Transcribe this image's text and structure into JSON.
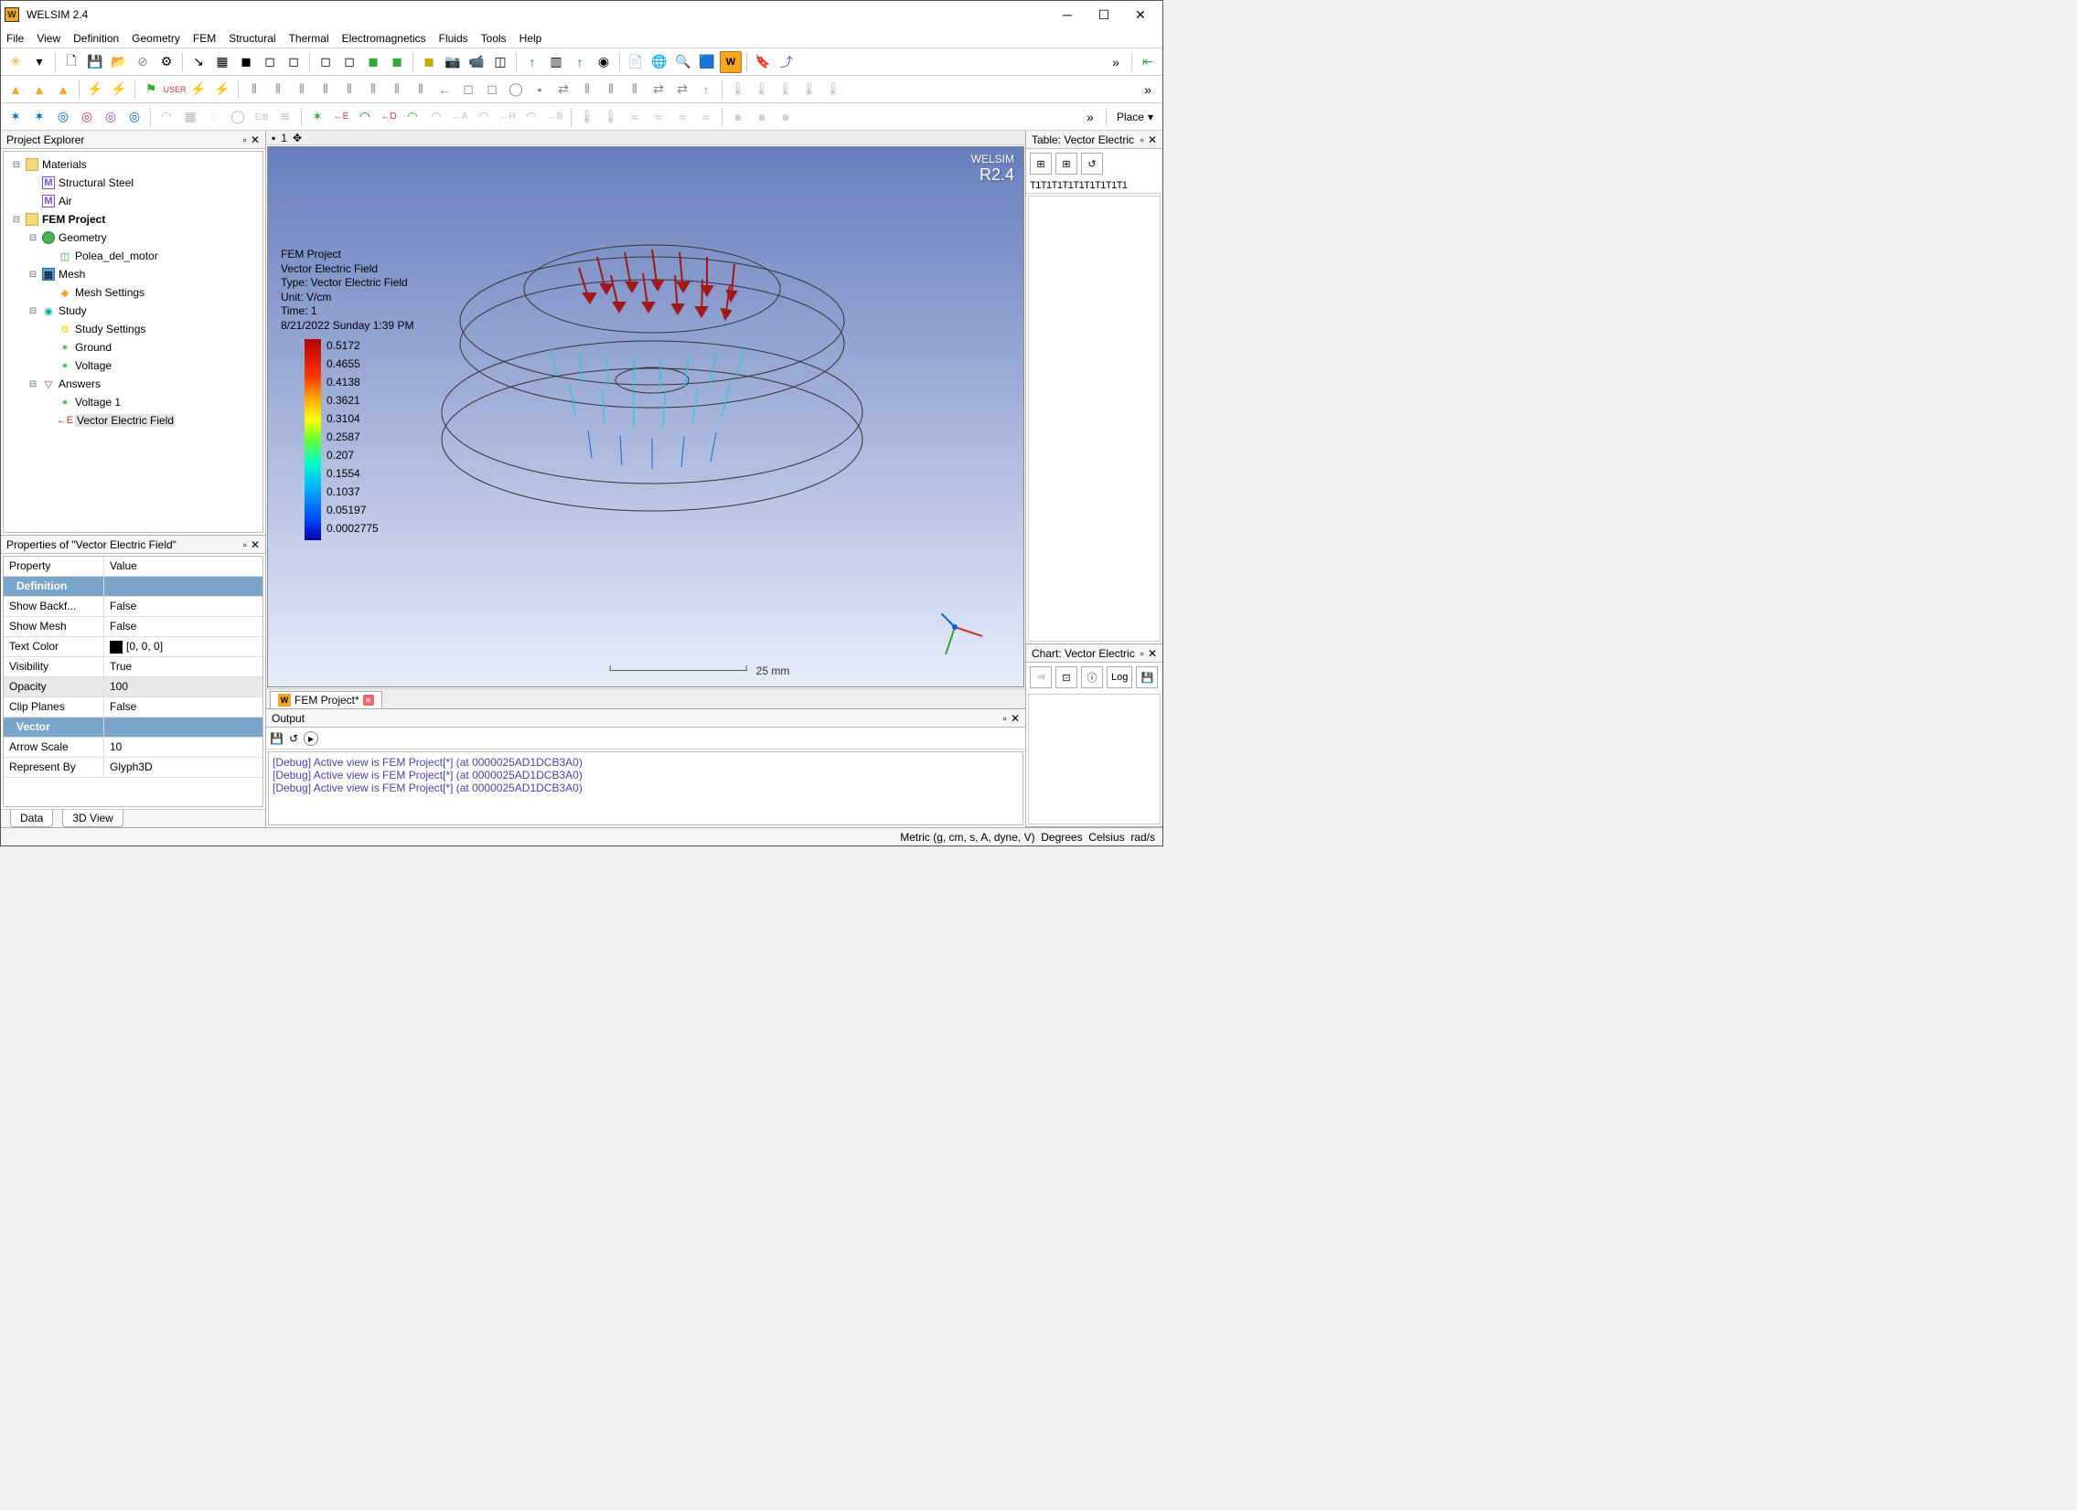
{
  "title": "WELSIM 2.4",
  "menu": [
    "File",
    "View",
    "Definition",
    "Geometry",
    "FEM",
    "Structural",
    "Thermal",
    "Electromagnetics",
    "Fluids",
    "Tools",
    "Help"
  ],
  "projectExplorer": {
    "title": "Project Explorer",
    "items": {
      "materials": "Materials",
      "structuralSteel": "Structural Steel",
      "air": "Air",
      "femProject": "FEM Project",
      "geometry": "Geometry",
      "part": "Polea_del_motor",
      "mesh": "Mesh",
      "meshSettings": "Mesh Settings",
      "study": "Study",
      "studySettings": "Study Settings",
      "ground": "Ground",
      "voltage": "Voltage",
      "answers": "Answers",
      "voltage1": "Voltage 1",
      "vectorElectric": "Vector Electric Field"
    }
  },
  "propsPanel": {
    "title": "Properties of \"Vector Electric Field\"",
    "headProp": "Property",
    "headVal": "Value",
    "catDefinition": "Definition",
    "showBackface": {
      "k": "Show Backf...",
      "v": "False"
    },
    "showMesh": {
      "k": "Show Mesh",
      "v": "False"
    },
    "textColor": {
      "k": "Text Color",
      "v": "[0, 0, 0]"
    },
    "visibility": {
      "k": "Visibility",
      "v": "True"
    },
    "opacity": {
      "k": "Opacity",
      "v": "100"
    },
    "clipPlanes": {
      "k": "Clip Planes",
      "v": "False"
    },
    "catVector": "Vector",
    "arrowScale": {
      "k": "Arrow Scale",
      "v": "10"
    },
    "representBy": {
      "k": "Represent By",
      "v": "Glyph3D"
    },
    "tabData": "Data",
    "tab3D": "3D View"
  },
  "viewport": {
    "brand": "WELSIM",
    "version": "R2.4",
    "info": {
      "l1": "FEM Project",
      "l2": "Vector Electric Field",
      "l3": "Type: Vector Electric Field",
      "l4": "Unit: V/cm",
      "l5": "Time: 1",
      "l6": "8/21/2022 Sunday 1:39 PM"
    },
    "legendValues": [
      "0.5172",
      "0.4655",
      "0.4138",
      "0.3621",
      "0.3104",
      "0.2587",
      "0.207",
      "0.1554",
      "0.1037",
      "0.05197",
      "0.0002775"
    ],
    "scaleLabel": "25 mm",
    "tabLabel": "FEM Project*",
    "miniTab": "1"
  },
  "tablePanel": {
    "title": "Table: Vector Electric ",
    "cols": "T1T1T1T1T1T1T1T1T1"
  },
  "chartPanel": {
    "title": "Chart: Vector Electric ",
    "logBtn": "Log"
  },
  "toolbarRight": {
    "placeLabel": "Place"
  },
  "outputPanel": {
    "title": "Output",
    "lines": [
      "[Debug] Active view is FEM Project[*] (at 0000025AD1DCB3A0)",
      "[Debug] Active view is FEM Project[*] (at 0000025AD1DCB3A0)",
      "[Debug] Active view is FEM Project[*] (at 0000025AD1DCB3A0)"
    ]
  },
  "status": {
    "units": "Metric (g, cm, s, A, dyne, V)",
    "ang": "Degrees",
    "temp": "Celsius",
    "rot": "rad/s"
  }
}
